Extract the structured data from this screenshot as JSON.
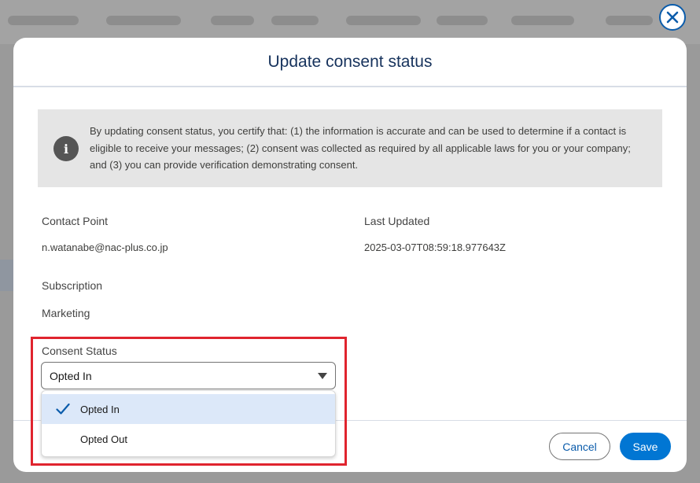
{
  "modal": {
    "title": "Update consent status",
    "notice": "By updating consent status, you certify that: (1) the information is accurate and can be used to determine if a contact is eligible to receive your messages; (2) consent was collected as required by all applicable laws for you or your company; and (3) you can provide verification demonstrating consent.",
    "contact_point_label": "Contact Point",
    "contact_point_value": "n.watanabe@nac-plus.co.jp",
    "last_updated_label": "Last Updated",
    "last_updated_value": "2025-03-07T08:59:18.977643Z",
    "subscription_label": "Subscription",
    "subscription_value": "Marketing",
    "consent_status_label": "Consent Status",
    "consent_status_value": "Opted In",
    "options": [
      "Opted In",
      "Opted Out"
    ],
    "cancel_label": "Cancel",
    "save_label": "Save"
  },
  "colors": {
    "brand": "#0176d3",
    "highlight": "#e0242e",
    "selected_option_bg": "#dce8f9"
  },
  "icons": {
    "close": "close-icon",
    "info": "info-icon",
    "check": "check-icon",
    "caret": "caret-down-icon"
  }
}
